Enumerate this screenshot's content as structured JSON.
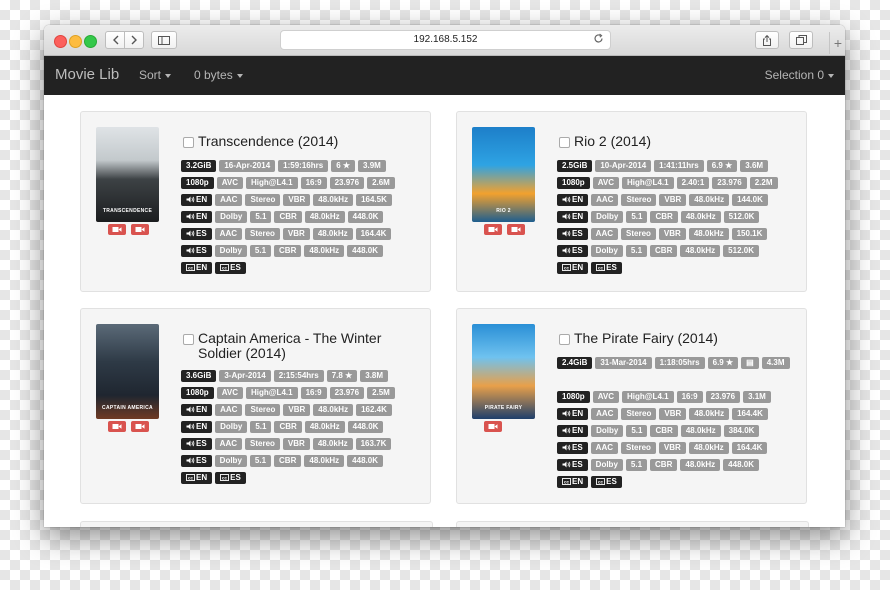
{
  "browser": {
    "url": "192.168.5.152"
  },
  "navbar": {
    "brand": "Movie Lib",
    "sort_label": "Sort",
    "size_label": "0 bytes",
    "selection_label": "Selection 0"
  },
  "movies": [
    {
      "title": "Transcendence (2014)",
      "poster_text": "TRANSCENDENCE",
      "trailers": 2,
      "rows": [
        [
          "3.2GiB",
          "16-Apr-2014",
          "1:59:16hrs",
          "6 ★",
          "3.9M"
        ],
        [
          "1080p",
          "AVC",
          "High@L4.1",
          "16:9",
          "23.976",
          "2.6M"
        ],
        [
          "EN",
          "AAC",
          "Stereo",
          "VBR",
          "48.0kHz",
          "164.5K"
        ],
        [
          "EN",
          "Dolby",
          "5.1",
          "CBR",
          "48.0kHz",
          "448.0K"
        ],
        [
          "ES",
          "AAC",
          "Stereo",
          "VBR",
          "48.0kHz",
          "164.4K"
        ],
        [
          "ES",
          "Dolby",
          "5.1",
          "CBR",
          "48.0kHz",
          "448.0K"
        ],
        [
          "EN",
          "ES"
        ]
      ]
    },
    {
      "title": "Rio 2 (2014)",
      "poster_text": "RIO 2",
      "trailers": 2,
      "rows": [
        [
          "2.5GiB",
          "10-Apr-2014",
          "1:41:11hrs",
          "6.9 ★",
          "3.6M"
        ],
        [
          "1080p",
          "AVC",
          "High@L4.1",
          "2.40:1",
          "23.976",
          "2.2M"
        ],
        [
          "EN",
          "AAC",
          "Stereo",
          "VBR",
          "48.0kHz",
          "144.0K"
        ],
        [
          "EN",
          "Dolby",
          "5.1",
          "CBR",
          "48.0kHz",
          "512.0K"
        ],
        [
          "ES",
          "AAC",
          "Stereo",
          "VBR",
          "48.0kHz",
          "150.1K"
        ],
        [
          "ES",
          "Dolby",
          "5.1",
          "CBR",
          "48.0kHz",
          "512.0K"
        ],
        [
          "EN",
          "ES"
        ]
      ]
    },
    {
      "title": "Captain America - The Winter Soldier (2014)",
      "poster_text": "CAPTAIN AMERICA",
      "trailers": 2,
      "rows": [
        [
          "3.6GiB",
          "3-Apr-2014",
          "2:15:54hrs",
          "7.8 ★",
          "3.8M"
        ],
        [
          "1080p",
          "AVC",
          "High@L4.1",
          "16:9",
          "23.976",
          "2.5M"
        ],
        [
          "EN",
          "AAC",
          "Stereo",
          "VBR",
          "48.0kHz",
          "162.4K"
        ],
        [
          "EN",
          "Dolby",
          "5.1",
          "CBR",
          "48.0kHz",
          "448.0K"
        ],
        [
          "ES",
          "AAC",
          "Stereo",
          "VBR",
          "48.0kHz",
          "163.7K"
        ],
        [
          "ES",
          "Dolby",
          "5.1",
          "CBR",
          "48.0kHz",
          "448.0K"
        ],
        [
          "EN",
          "ES"
        ]
      ]
    },
    {
      "title": "The Pirate Fairy (2014)",
      "poster_text": "PIRATE FAIRY",
      "trailers": 1,
      "rows": [
        [
          "2.4GiB",
          "31-Mar-2014",
          "1:18:05hrs",
          "6.9 ★",
          "▤",
          "4.3M"
        ],
        [
          "1080p",
          "AVC",
          "High@L4.1",
          "16:9",
          "23.976",
          "3.1M"
        ],
        [
          "EN",
          "AAC",
          "Stereo",
          "VBR",
          "48.0kHz",
          "164.4K"
        ],
        [
          "EN",
          "Dolby",
          "5.1",
          "CBR",
          "48.0kHz",
          "384.0K"
        ],
        [
          "ES",
          "AAC",
          "Stereo",
          "VBR",
          "48.0kHz",
          "164.4K"
        ],
        [
          "ES",
          "Dolby",
          "5.1",
          "CBR",
          "48.0kHz",
          "448.0K"
        ],
        [
          "EN",
          "ES"
        ]
      ]
    }
  ]
}
